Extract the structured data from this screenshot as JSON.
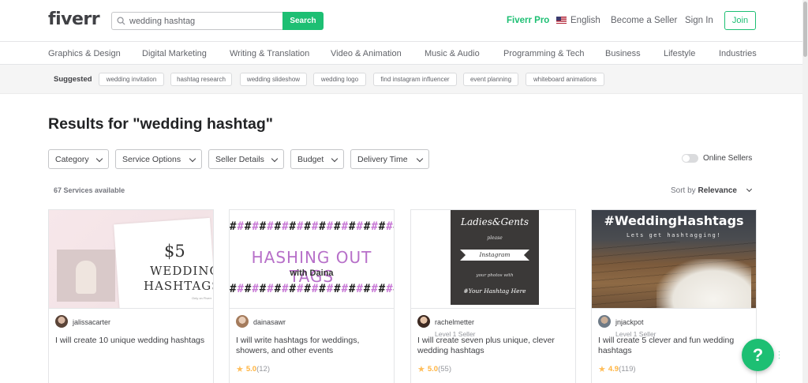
{
  "header": {
    "logo": "fiverr",
    "search_value": "wedding hashtag",
    "search_button": "Search",
    "fiverr_pro": "Fiverr Pro",
    "language": "English",
    "become_seller": "Become a Seller",
    "sign_in": "Sign In",
    "join": "Join"
  },
  "categories": [
    "Graphics & Design",
    "Digital Marketing",
    "Writing & Translation",
    "Video & Animation",
    "Music & Audio",
    "Programming & Tech",
    "Business",
    "Lifestyle",
    "Industries"
  ],
  "suggested": {
    "label": "Suggested",
    "chips": [
      "wedding invitation",
      "hashtag research",
      "wedding slideshow",
      "wedding logo",
      "find instagram influencer",
      "event planning",
      "whiteboard animations"
    ]
  },
  "results": {
    "title": "Results for \"wedding hashtag\"",
    "filters": [
      "Category",
      "Service Options",
      "Seller Details",
      "Budget",
      "Delivery Time"
    ],
    "online_sellers": "Online Sellers",
    "count": "67 Services available",
    "sort_label": "Sort by",
    "sort_value": "Relevance"
  },
  "cards": [
    {
      "seller": "jalissacarter",
      "level": "",
      "title": "I will create 10 unique wedding hashtags",
      "score": "",
      "reviews": "",
      "thumb": {
        "price": "$5",
        "line1": "WEDDING",
        "line2": "HASHTAGS",
        "small": "Only on Fiverr"
      }
    },
    {
      "seller": "dainasawr",
      "level": "",
      "title": "I will write hashtags for weddings, showers, and other events",
      "score": "5.0",
      "reviews": "(12)",
      "thumb": {
        "pattern": "#######################",
        "main": "HASHING OUT TAGS",
        "sub": "with Daina"
      }
    },
    {
      "seller": "rachelmetter",
      "level": "Level 1 Seller",
      "title": "I will create seven plus unique, clever wedding hashtags",
      "score": "5.0",
      "reviews": "(55)",
      "thumb": {
        "title": "Ladies&Gents",
        "please": "please",
        "ribbon": "Instagram",
        "small": "your photos with",
        "hash": "#Your Hashtag Here"
      }
    },
    {
      "seller": "jnjackpot",
      "level": "Level 1 Seller",
      "title": "I will create 5 clever and fun wedding hashtags",
      "score": "4.9",
      "reviews": "(119)",
      "thumb": {
        "title": "#WeddingHashtags",
        "sub": "Lets get hashtagging!"
      }
    }
  ],
  "help": {
    "label": "?"
  },
  "colors": {
    "brand_green": "#1dbf73",
    "star": "#ffbe5b"
  }
}
